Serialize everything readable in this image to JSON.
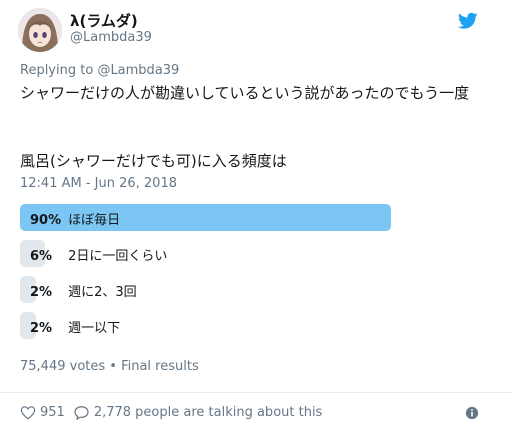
{
  "colors": {
    "accent": "#1da1f2",
    "winner_bar": "#7bc6f2",
    "bar": "#e1e8ed",
    "muted": "#657786",
    "text": "#14171a"
  },
  "author": {
    "display_name": "λ(ラムダ)",
    "handle": "@Lambda39",
    "avatar_icon": "anime-avatar-icon"
  },
  "reply": {
    "prefix": "Replying to",
    "mention": "@Lambda39"
  },
  "tweet": {
    "body": "シャワーだけの人が勘違いしているという説があったのでもう一度",
    "question": "風呂(シャワーだけでも可)に入る頻度は",
    "timestamp": "12:41 AM - Jun 26, 2018"
  },
  "poll": {
    "options": [
      {
        "percent_label": "90%",
        "choice": "ほぼ毎日",
        "fraction": 0.9,
        "winner": true
      },
      {
        "percent_label": "6%",
        "choice": "2日に一回くらい",
        "fraction": 0.06,
        "winner": false
      },
      {
        "percent_label": "2%",
        "choice": "週に2、3回",
        "fraction": 0.02,
        "winner": false
      },
      {
        "percent_label": "2%",
        "choice": "週一以下",
        "fraction": 0.02,
        "winner": false
      }
    ],
    "summary": "75,449 votes • Final results"
  },
  "actions": {
    "like_count": "951",
    "reply_text": "2,778 people are talking about this",
    "like_icon": "heart-icon",
    "reply_icon": "speech-bubble-icon",
    "info_icon": "info-icon"
  }
}
